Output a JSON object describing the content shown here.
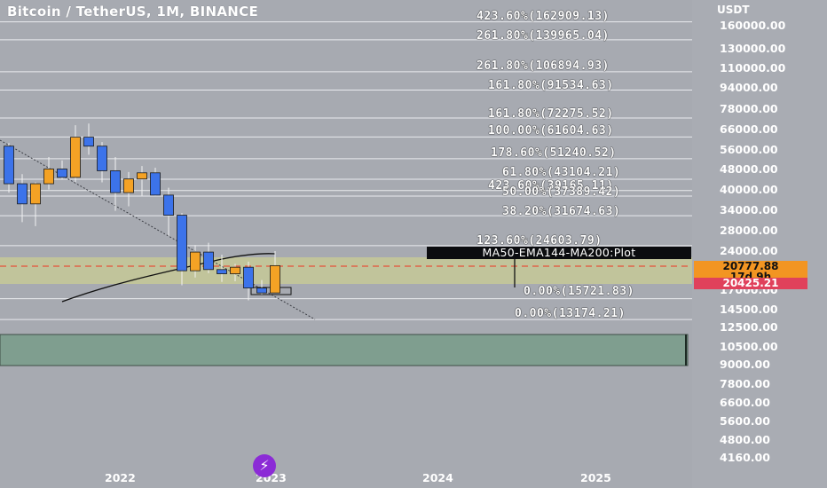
{
  "header": {
    "title": "Bitcoin / TetherUS, 1M, BINANCE",
    "currency": "USDT"
  },
  "colors": {
    "background": "#a7aab1",
    "bull": "#f4a225",
    "bear": "#3c73ea",
    "zone_fill": "#c8cb93",
    "lower_box": "#7c9c8c",
    "last_price_bg": "#f29522",
    "low_price_bg": "#e0415b",
    "logo": "#8b2bd6"
  },
  "fib_labels": [
    "423.60%(162909.13)",
    "261.80%(139965.04)",
    "261.80%(106894.93)",
    "161.80%(91534.63)",
    "161.80%(72275.52)",
    "100.00%(61604.63)",
    "178.60%(51240.52)",
    "61.80%(43104.21)",
    "423.60%(39165.11)",
    "50.00%(37389.42)",
    "38.20%(31674.63)",
    "123.60%(24603.79)",
    "0.00%(15721.83)",
    "0.00%(13174.21)"
  ],
  "indicator_label": "MA50-EMA144-MA200:Plot",
  "price_axis": {
    "ticks": [
      "160000.00",
      "130000.00",
      "110000.00",
      "94000.00",
      "78000.00",
      "66000.00",
      "56000.00",
      "48000.00",
      "40000.00",
      "34000.00",
      "28000.00",
      "24000.00",
      "17000.00",
      "14500.00",
      "12500.00",
      "10500.00",
      "9000.00",
      "7800.00",
      "6600.00",
      "5600.00",
      "4800.00",
      "4160.00"
    ],
    "last_price": "20777.88",
    "countdown": "17d 9h",
    "low_price": "20425.21"
  },
  "time_axis": {
    "ticks": [
      "2022",
      "2023",
      "2024",
      "2025"
    ]
  },
  "logo_glyph": "⚡",
  "chart_data": {
    "type": "candlestick",
    "title": "Bitcoin / TetherUS, 1M, BINANCE",
    "ylabel": "USDT",
    "scale": "log",
    "ylim": [
      4160,
      175000
    ],
    "candles": [
      {
        "o": 57000,
        "h": 58500,
        "l": 38500,
        "c": 41500
      },
      {
        "o": 41500,
        "h": 45000,
        "l": 30000,
        "c": 35000
      },
      {
        "o": 35000,
        "h": 42000,
        "l": 29000,
        "c": 41500
      },
      {
        "o": 41500,
        "h": 52000,
        "l": 39500,
        "c": 47000
      },
      {
        "o": 47000,
        "h": 50500,
        "l": 43000,
        "c": 43800
      },
      {
        "o": 43800,
        "h": 68000,
        "l": 42000,
        "c": 61500
      },
      {
        "o": 61500,
        "h": 69000,
        "l": 53000,
        "c": 57000
      },
      {
        "o": 57000,
        "h": 59000,
        "l": 42000,
        "c": 46300
      },
      {
        "o": 46300,
        "h": 52000,
        "l": 33000,
        "c": 38500
      },
      {
        "o": 38500,
        "h": 45800,
        "l": 34300,
        "c": 43200
      },
      {
        "o": 43200,
        "h": 48200,
        "l": 37500,
        "c": 45500
      },
      {
        "o": 45500,
        "h": 47500,
        "l": 37500,
        "c": 37700
      },
      {
        "o": 37700,
        "h": 40100,
        "l": 26700,
        "c": 31800
      },
      {
        "o": 31800,
        "h": 32400,
        "l": 17600,
        "c": 19900
      },
      {
        "o": 19900,
        "h": 24700,
        "l": 18800,
        "c": 23300
      },
      {
        "o": 23300,
        "h": 25200,
        "l": 19500,
        "c": 20100
      },
      {
        "o": 20100,
        "h": 22800,
        "l": 18100,
        "c": 19400
      },
      {
        "o": 19400,
        "h": 21100,
        "l": 18200,
        "c": 20500
      },
      {
        "o": 20500,
        "h": 21500,
        "l": 15500,
        "c": 17200
      },
      {
        "o": 17200,
        "h": 18400,
        "l": 16300,
        "c": 16500
      },
      {
        "o": 16500,
        "h": 23500,
        "l": 16500,
        "c": 20778
      }
    ],
    "annotations": {
      "last_price": 20777.88,
      "low_price": 20425.21
    }
  }
}
